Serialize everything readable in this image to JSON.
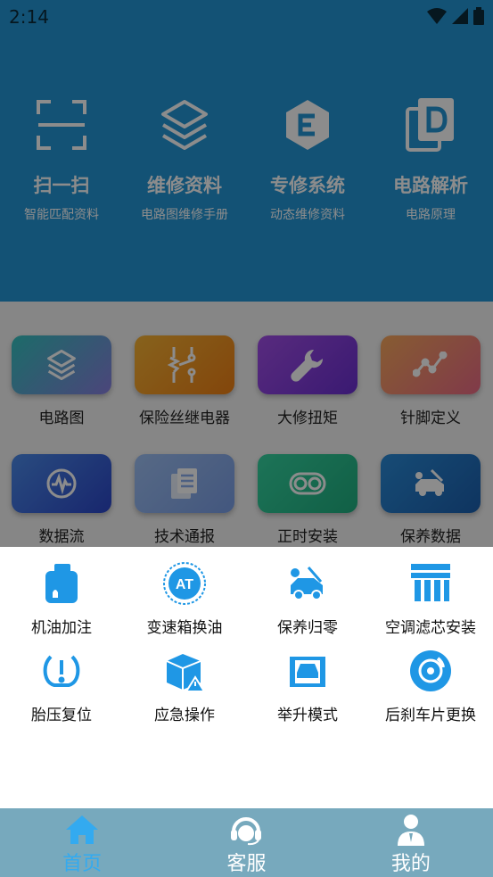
{
  "status": {
    "time": "2:14"
  },
  "top_items": [
    {
      "title": "扫一扫",
      "sub": "智能匹配资料",
      "icon": "scan-icon"
    },
    {
      "title": "维修资料",
      "sub": "电路图维修手册",
      "icon": "layers-icon"
    },
    {
      "title": "专修系统",
      "sub": "动态维修资料",
      "icon": "hexagon-e-icon"
    },
    {
      "title": "电路解析",
      "sub": "电路原理",
      "icon": "document-d-icon"
    }
  ],
  "grid_items": [
    {
      "label": "电路图",
      "icon": "layers-icon",
      "color": "#3fb6c9"
    },
    {
      "label": "保险丝继电器",
      "icon": "circuit-icon",
      "color": "#f2a029"
    },
    {
      "label": "大修扭矩",
      "icon": "wrench-icon",
      "color": "#8a3fd6"
    },
    {
      "label": "针脚定义",
      "icon": "pin-graph-icon",
      "color": "#f2926c"
    },
    {
      "label": "数据流",
      "icon": "data-flow-icon",
      "color": "#3e6fe0"
    },
    {
      "label": "技术通报",
      "icon": "files-icon",
      "color": "#8fb2ee"
    },
    {
      "label": "正时安装",
      "icon": "timing-belt-icon",
      "color": "#2dc48f"
    },
    {
      "label": "保养数据",
      "icon": "car-service-icon",
      "color": "#2179c9"
    }
  ],
  "sheet_items": [
    {
      "label": "机油加注",
      "icon": "oil-can-icon"
    },
    {
      "label": "变速箱换油",
      "icon": "at-gear-icon"
    },
    {
      "label": "保养归零",
      "icon": "car-service-icon"
    },
    {
      "label": "空调滤芯安装",
      "icon": "ac-filter-icon"
    },
    {
      "label": "胎压复位",
      "icon": "tire-pressure-icon"
    },
    {
      "label": "应急操作",
      "icon": "emergency-box-icon"
    },
    {
      "label": "举升模式",
      "icon": "car-lift-icon"
    },
    {
      "label": "后刹车片更换",
      "icon": "brake-disc-icon"
    }
  ],
  "nav": [
    {
      "label": "首页",
      "icon": "home-icon",
      "active": true
    },
    {
      "label": "客服",
      "icon": "headset-icon",
      "active": false
    },
    {
      "label": "我的",
      "icon": "profile-icon",
      "active": false
    }
  ],
  "colors": {
    "accent": "#1f97e5",
    "header_bg": "#2395d6",
    "nav_bg": "#77a9bd",
    "nav_active": "#33aaf0"
  }
}
